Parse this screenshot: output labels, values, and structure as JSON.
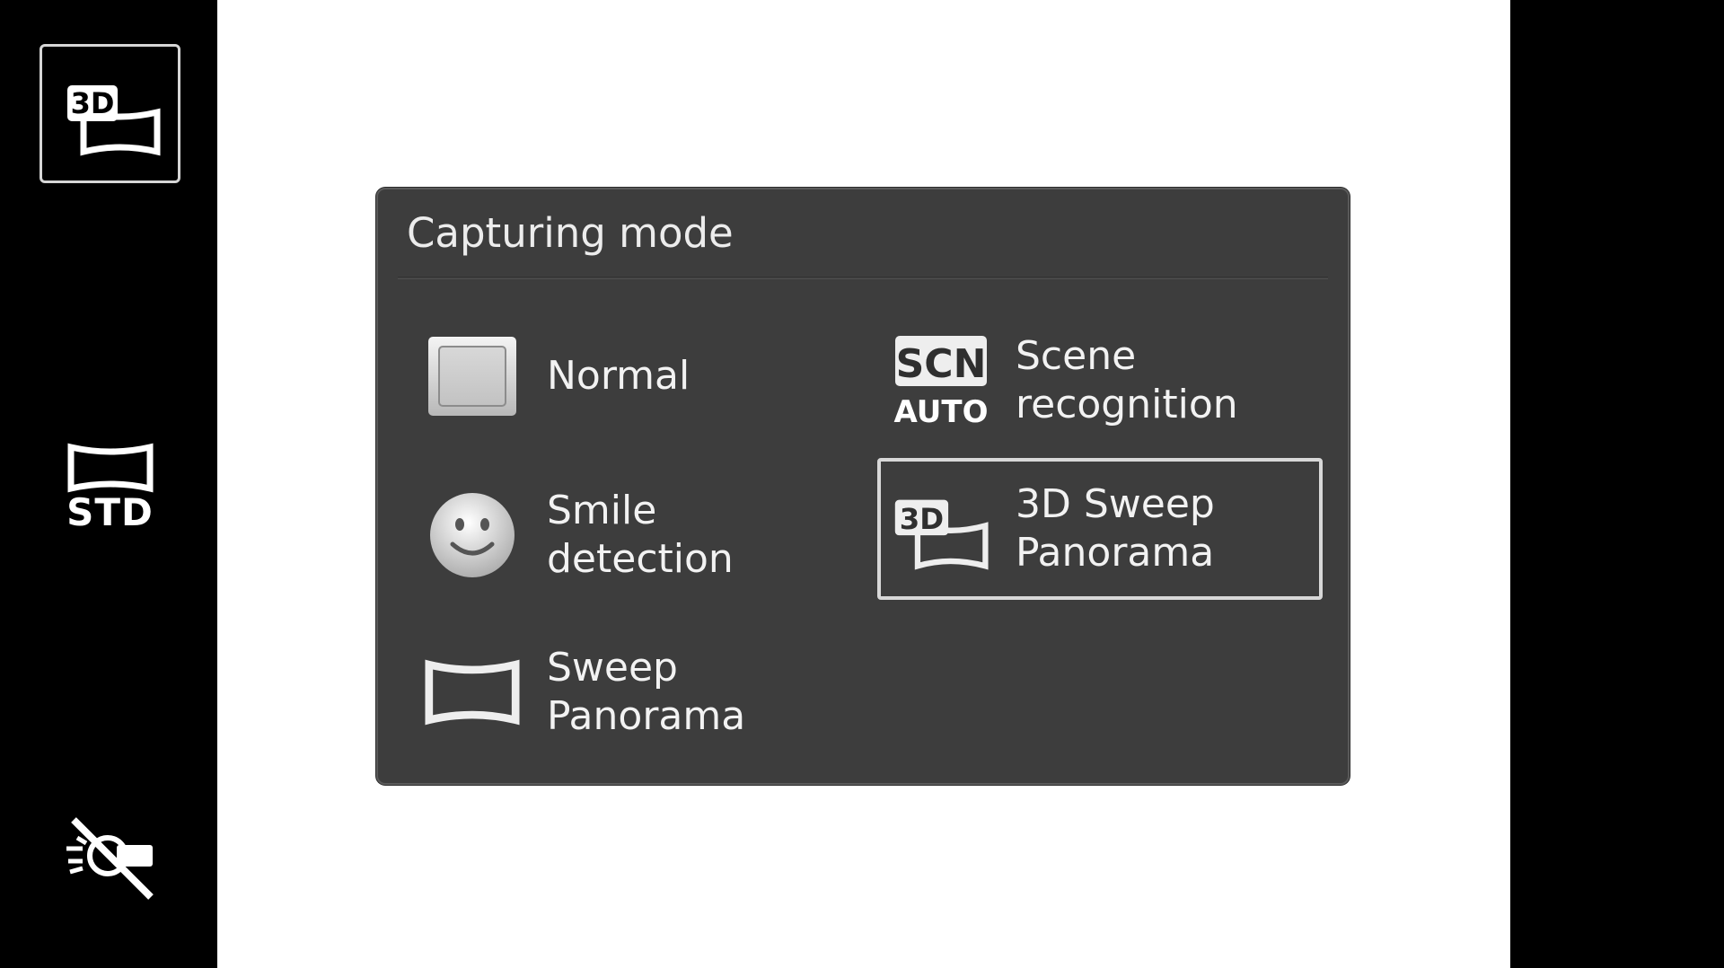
{
  "rail": {
    "mode_icon": "3d-sweep-panorama-icon",
    "size_label": "STD",
    "size_icon": "panorama-std-icon",
    "flash_icon": "flash-off-icon"
  },
  "dialog": {
    "title": "Capturing mode",
    "options": [
      {
        "label": "Normal",
        "icon": "normal-mode-icon",
        "selected": false
      },
      {
        "label": "Smile\ndetection",
        "icon": "smile-face-icon",
        "selected": false
      },
      {
        "label": "Sweep\nPanorama",
        "icon": "sweep-panorama-icon",
        "selected": false
      },
      {
        "label": "Scene\nrecognition",
        "icon": "scn-auto-icon",
        "selected": false
      },
      {
        "label": "3D Sweep\nPanorama",
        "icon": "3d-sweep-panorama-icon",
        "selected": true
      }
    ]
  },
  "icon_text": {
    "scn": "SCN",
    "auto": "AUTO",
    "three_d": "3D"
  },
  "colors": {
    "dialog_bg": "#3d3d3d",
    "text": "#f2f2f2",
    "selection_border": "#d8d8d8",
    "viewfinder": "#ffffff"
  }
}
